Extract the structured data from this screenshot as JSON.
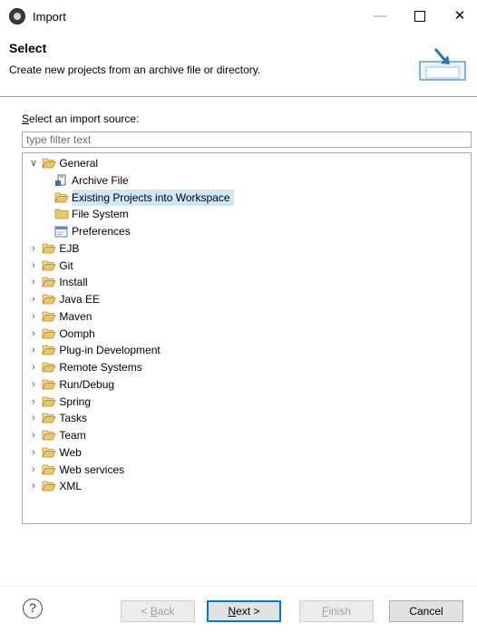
{
  "window": {
    "title": "Import"
  },
  "header": {
    "title": "Select",
    "description": "Create new projects from an archive file or directory."
  },
  "source": {
    "label": "Select an import source:",
    "filter_placeholder": "type filter text"
  },
  "tree": {
    "general": {
      "label": "General",
      "children": [
        {
          "label": "Archive File",
          "icon": "archive-file-icon"
        },
        {
          "label": "Existing Projects into Workspace",
          "icon": "open-folder-icon",
          "selected": true
        },
        {
          "label": "File System",
          "icon": "folder-icon"
        },
        {
          "label": "Preferences",
          "icon": "preferences-icon"
        }
      ]
    },
    "categories": [
      "EJB",
      "Git",
      "Install",
      "Java EE",
      "Maven",
      "Oomph",
      "Plug-in Development",
      "Remote Systems",
      "Run/Debug",
      "Spring",
      "Tasks",
      "Team",
      "Web",
      "Web services",
      "XML"
    ]
  },
  "buttons": {
    "back": "< Back",
    "next": "Next >",
    "finish": "Finish",
    "cancel": "Cancel"
  },
  "colors": {
    "selection": "#cce8ff",
    "default_button_border": "#0078d7",
    "folder": "#e8c86a"
  }
}
